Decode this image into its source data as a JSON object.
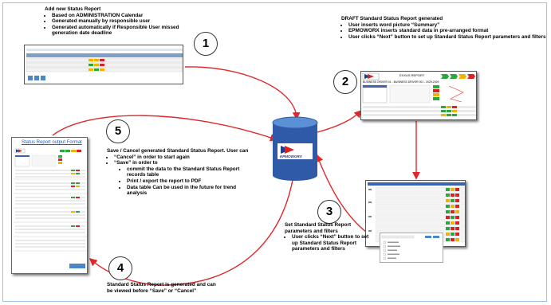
{
  "steps": [
    {
      "number": "1"
    },
    {
      "number": "2"
    },
    {
      "number": "3"
    },
    {
      "number": "4"
    },
    {
      "number": "5"
    }
  ],
  "step1": {
    "heading": "Add new Status Report",
    "bullets": [
      "Based on ADMINISTRATION Calendar",
      "Generated manually by responsible user",
      "Generated automatically if Responsible User missed generation date deadline"
    ]
  },
  "step2": {
    "heading": "DRAFT Standard Status Report generated",
    "bullets": [
      "User inserts word picture “Summary”",
      "EPMOWORX inserts standard data in pre-arranged format",
      "User clicks “Next” button to set up Standard Status Report parameters and filters"
    ]
  },
  "step3": {
    "heading": "Set Standard Status Report parameters and filters",
    "bullets": [
      "User clicks “Next” button to set up Standard Status Report parameters and filters"
    ]
  },
  "step4": {
    "text": "Standard Status Report is generated and can be viewed before “Save” or “Cancel”"
  },
  "step5": {
    "heading": "Save / Cancel generated Standard Status Report. User can",
    "bullets": [
      "“Cancel” in order to start again",
      "“Save” in order to"
    ],
    "sub_bullets": [
      "commit the data to the Standard Status Report records table",
      "Print / export the report to PDF",
      "Data table Can be used in the future for trend analysis"
    ]
  },
  "database": {
    "logo_text": "EPMOWORX"
  },
  "report_output": {
    "title": "Status Report output Format"
  },
  "draft_report": {
    "header": "EXXUS REPORT",
    "subheader": "BUSINESS DRIVER 01 - BUSINESS DRIVER 001 - 2029-2029"
  },
  "colors": {
    "arrow": "#e0282a",
    "database_top": "#5b8fd6",
    "database_body": "#2f5aa8",
    "rag_red": "#e02020",
    "rag_amber": "#f0b400",
    "rag_green": "#2aa83a",
    "border": "#9fc3e6"
  }
}
